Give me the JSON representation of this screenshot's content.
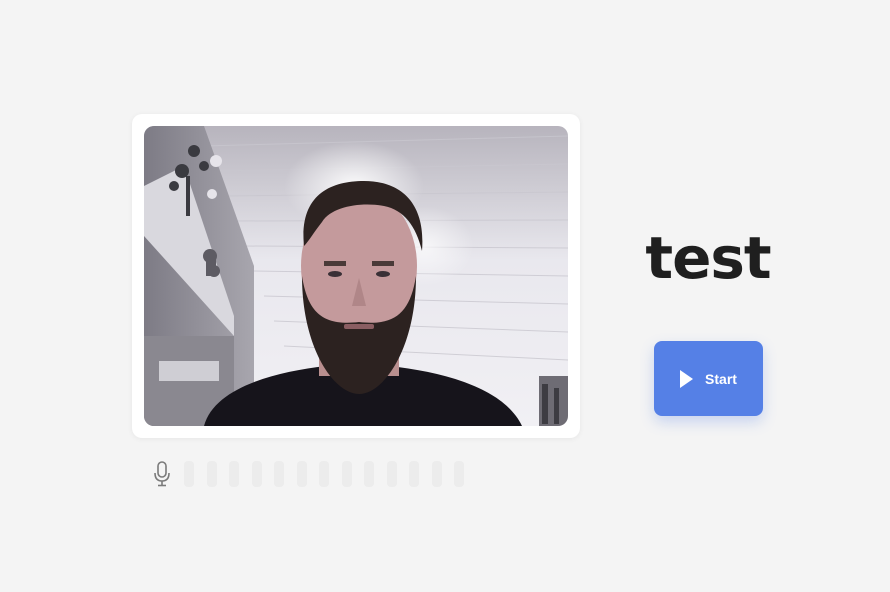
{
  "video": {
    "icon": "webcam-preview"
  },
  "audio": {
    "icon": "microphone-icon",
    "level_bar_count": 13,
    "level": 0
  },
  "heading": {
    "title": "test"
  },
  "actions": {
    "start_label": "Start",
    "start_icon": "play-icon",
    "accent_color": "#5580e6"
  }
}
